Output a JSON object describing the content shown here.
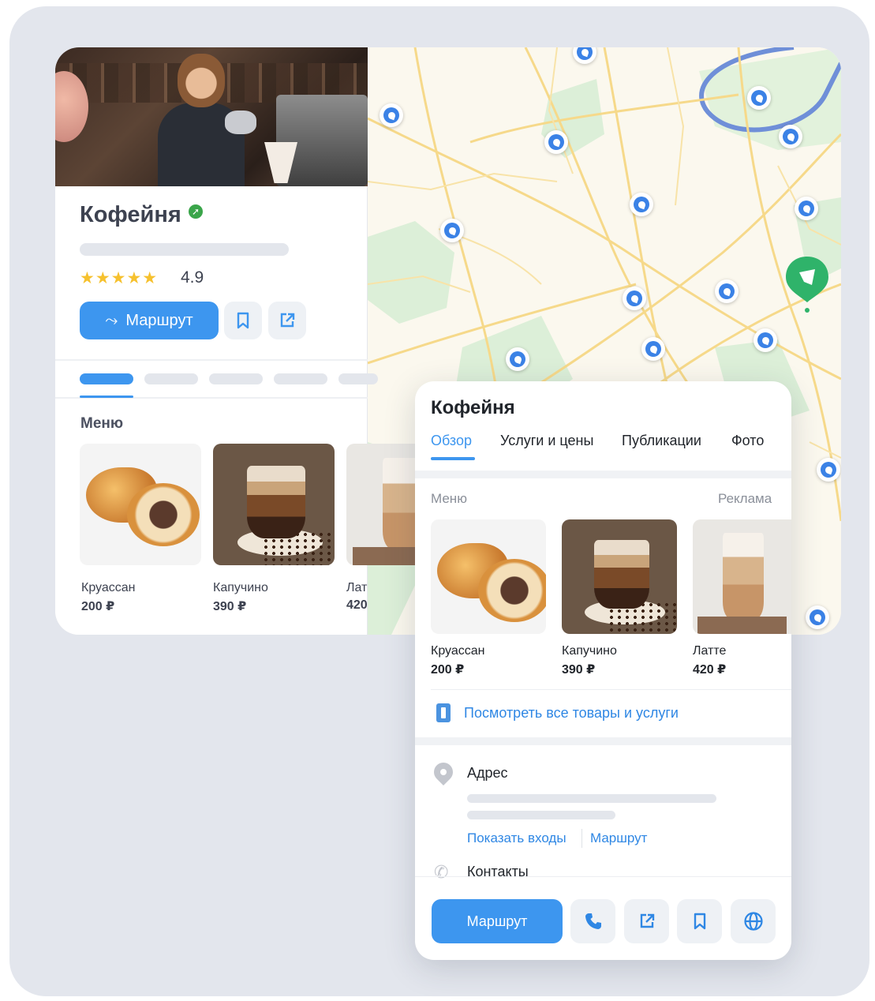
{
  "desktop": {
    "title": "Кофейня",
    "stars": "★★★★★",
    "rating": "4.9",
    "route_label": "Маршрут",
    "menu_title": "Меню",
    "items": [
      {
        "name": "Круассан",
        "price": "200 ₽"
      },
      {
        "name": "Капучино",
        "price": "390 ₽"
      },
      {
        "name": "Лат",
        "price": "420"
      }
    ]
  },
  "mobile": {
    "title": "Кофейня",
    "tabs": [
      {
        "label": "Обзор"
      },
      {
        "label": "Услуги и цены"
      },
      {
        "label": "Публикации"
      },
      {
        "label": "Фото"
      }
    ],
    "menu_label": "Меню",
    "ad_label": "Реклама",
    "items": [
      {
        "name": "Круассан",
        "price": "200 ₽"
      },
      {
        "name": "Капучино",
        "price": "390 ₽"
      },
      {
        "name": "Латте",
        "price": "420 ₽"
      }
    ],
    "all_goods_link": "Посмотреть все товары и услуги",
    "address_title": "Адрес",
    "show_entrances": "Показать входы",
    "route_link": "Маршрут",
    "contacts_title": "Контакты",
    "route_button": "Маршрут"
  },
  "colors": {
    "accent": "#3d96ef",
    "pin": "#3b82e6",
    "verified": "#3aa54a",
    "big_pin": "#2fb36a",
    "background": "#e3e6ed"
  },
  "icons": [
    "route-icon",
    "bookmark-icon",
    "share-icon",
    "phone-icon",
    "globe-icon",
    "location-icon",
    "book-icon",
    "map-pin-icon"
  ]
}
